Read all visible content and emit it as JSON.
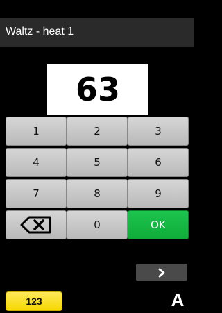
{
  "header": {
    "title": "Waltz - heat 1"
  },
  "display": {
    "value": "63"
  },
  "keypad": {
    "keys": [
      "1",
      "2",
      "3",
      "4",
      "5",
      "6",
      "7",
      "8",
      "9"
    ],
    "zero": "0",
    "ok": "OK",
    "backspace_icon": "backspace-icon"
  },
  "footer": {
    "numeric_mode": "123",
    "alpha_mode": "A",
    "next_icon": "chevron-right-icon"
  },
  "colors": {
    "background": "#000000",
    "header_bg": "#2a2a2a",
    "key_bg": "#c8c8c8",
    "ok_bg": "#16b845",
    "mode_button_bg": "#f5d800"
  }
}
